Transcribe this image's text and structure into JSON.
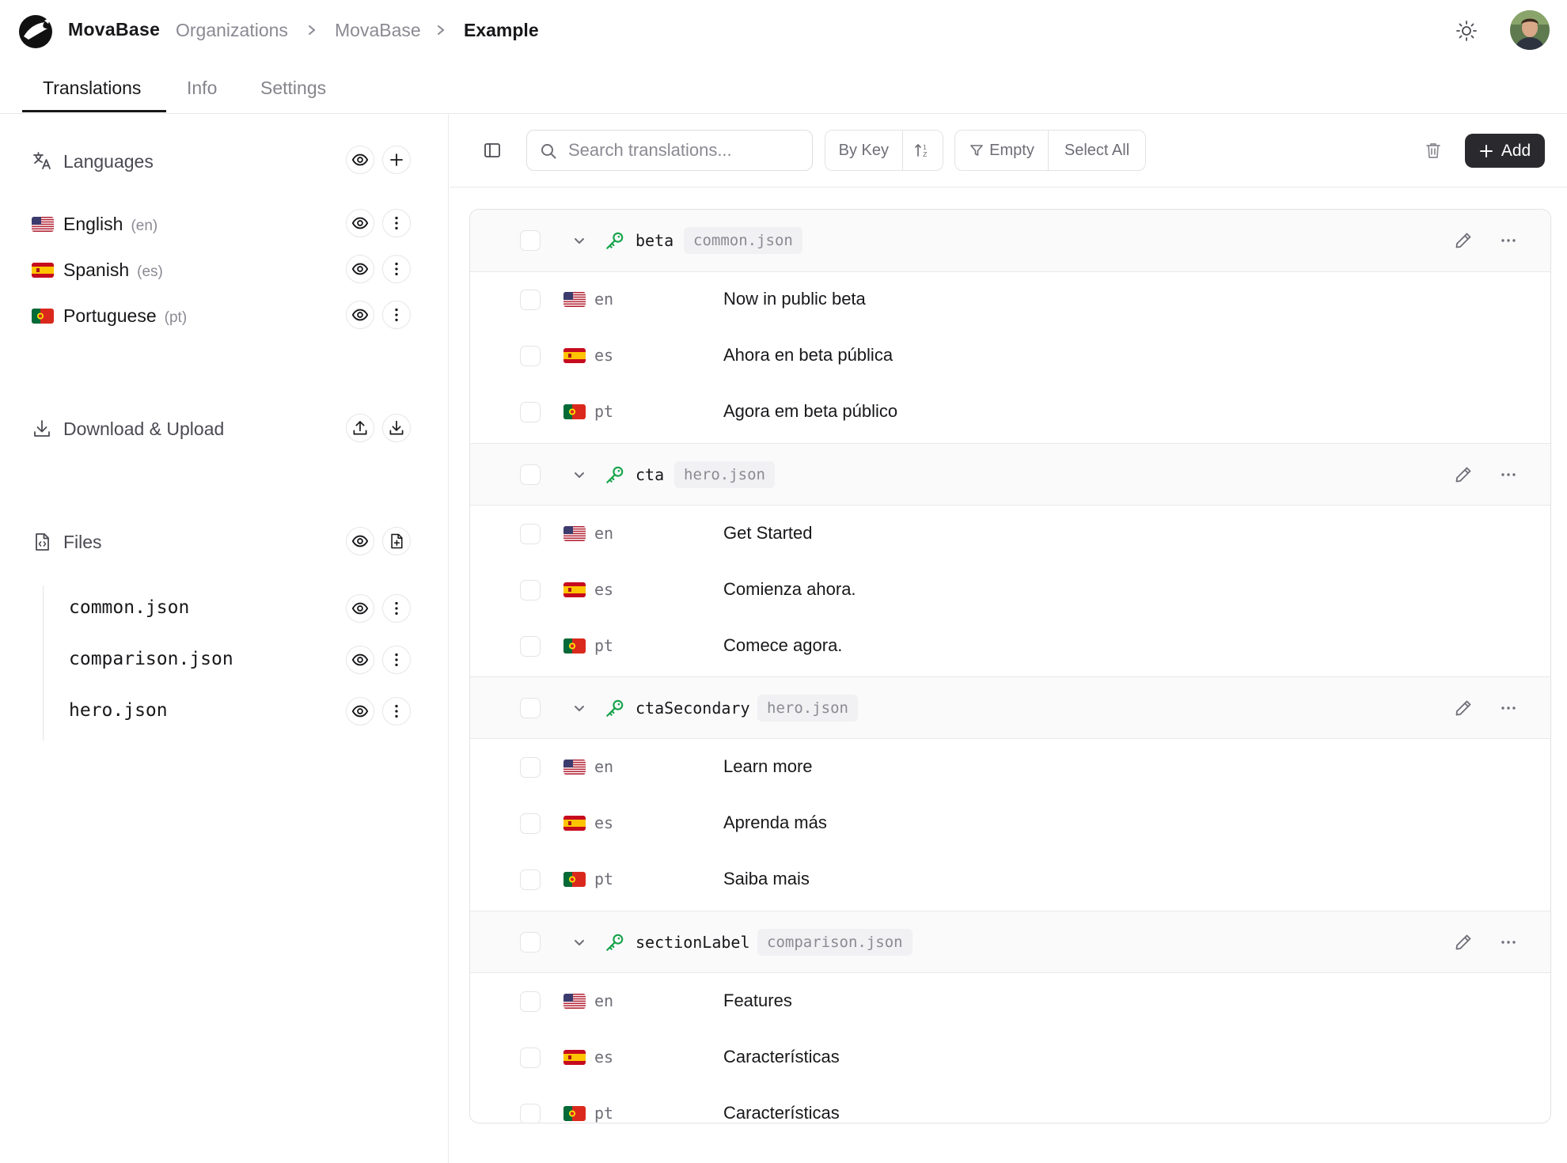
{
  "header": {
    "brand": "MovaBase",
    "breadcrumbs": [
      "Organizations",
      "MovaBase",
      "Example"
    ]
  },
  "tabs": [
    "Translations",
    "Info",
    "Settings"
  ],
  "sidebar": {
    "languages_title": "Languages",
    "languages": [
      {
        "name": "English",
        "code": "(en)"
      },
      {
        "name": "Spanish",
        "code": "(es)"
      },
      {
        "name": "Portuguese",
        "code": "(pt)"
      }
    ],
    "download_title": "Download & Upload",
    "files_title": "Files",
    "files": [
      "common.json",
      "comparison.json",
      "hero.json"
    ]
  },
  "toolbar": {
    "search_placeholder": "Search translations...",
    "sort_label": "By Key",
    "empty_label": "Empty",
    "select_all_label": "Select All",
    "add_label": "Add"
  },
  "entries": [
    {
      "key": "beta",
      "file": "common.json",
      "translations": [
        {
          "code": "en",
          "text": "Now in public beta"
        },
        {
          "code": "es",
          "text": "Ahora en beta pública"
        },
        {
          "code": "pt",
          "text": "Agora em beta público"
        }
      ]
    },
    {
      "key": "cta",
      "file": "hero.json",
      "translations": [
        {
          "code": "en",
          "text": "Get Started"
        },
        {
          "code": "es",
          "text": "Comienza ahora."
        },
        {
          "code": "pt",
          "text": "Comece agora."
        }
      ]
    },
    {
      "key": "ctaSecondary",
      "file": "hero.json",
      "translations": [
        {
          "code": "en",
          "text": "Learn more"
        },
        {
          "code": "es",
          "text": "Aprenda más"
        },
        {
          "code": "pt",
          "text": "Saiba mais"
        }
      ]
    },
    {
      "key": "sectionLabel",
      "file": "comparison.json",
      "translations": [
        {
          "code": "en",
          "text": "Features"
        },
        {
          "code": "es",
          "text": "Características"
        },
        {
          "code": "pt",
          "text": "Características"
        }
      ]
    }
  ],
  "colors": {
    "accent_dark": "#2a2a2e",
    "key_icon": "#16a34a",
    "muted_text": "#8a8a93",
    "border": "#e3e3e7"
  }
}
